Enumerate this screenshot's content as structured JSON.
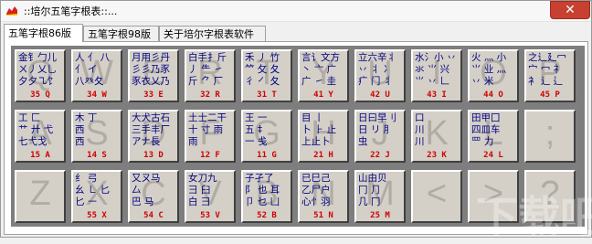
{
  "window": {
    "title": "::培尔五笔字根表::...",
    "close_glyph": "✕"
  },
  "tabs": [
    {
      "label": "五笔字根86版",
      "active": true
    },
    {
      "label": "五笔字根98版",
      "active": false
    },
    {
      "label": "关于培尔字根表软件",
      "active": false
    }
  ],
  "rows": [
    [
      {
        "big": "Q",
        "lines": [
          "金钅勹儿",
          "ㄨ丿乂乚",
          "夕夕㇈饣"
        ],
        "code": "35 Q"
      },
      {
        "big": "W",
        "lines": [
          "人  亻  八",
          "亻   イ",
          "八癶夂"
        ],
        "code": "34 W"
      },
      {
        "big": "E",
        "lines": [
          "月用彡丹",
          "彡彡乃豕",
          "豕衣乂乃"
        ],
        "code": "33 E"
      },
      {
        "big": "R",
        "lines": [
          "白手扌斤",
          "丿  ⺧  ㇀",
          "斤  ⺈  厂"
        ],
        "code": "32 R"
      },
      {
        "big": "T",
        "lines": [
          "禾 丿  竹",
          "⺮  攵  夂",
          "彳  ㇒  夂"
        ],
        "code": "31 T"
      },
      {
        "big": "Y",
        "lines": [
          "言讠文方",
          "丶  亠  广",
          "广  ㇀  圭"
        ],
        "code": "41 Y"
      },
      {
        "big": "U",
        "lines": [
          "立六辛丬",
          "丷  丬  冫",
          "疒  门  丬"
        ],
        "code": "42 U"
      },
      {
        "big": "I",
        "lines": [
          "水氵小 丷",
          "氺  ⺌  兴",
          "⺌  丷  𠃊"
        ],
        "code": "43 I"
      },
      {
        "big": "O",
        "lines": [
          "火 灬  小",
          "⺌  业  灬",
          "  丷  米"
        ],
        "code": "44 O"
      },
      {
        "big": "P",
        "lines": [
          "之辶廴冖",
          "宀  冖  礻",
          "衤  辶  ⻍"
        ],
        "code": "45 P"
      }
    ],
    [
      {
        "big": "A",
        "lines": [
          "工  匚",
          "艹  廾  弋",
          "七弋戈"
        ],
        "code": "15 A"
      },
      {
        "big": "S",
        "lines": [
          "木  丁",
          "  西  ",
          "西"
        ],
        "code": "14 S"
      },
      {
        "big": "D",
        "lines": [
          "大犬古石",
          "三手丰厂",
          "アナ長"
        ],
        "code": "13 D"
      },
      {
        "big": "F",
        "lines": [
          "土士二干",
          "十  寸  雨",
          "雨"
        ],
        "code": "12 F"
      },
      {
        "big": "G",
        "lines": [
          "王    一",
          "  五  ‡",
          "一    戋"
        ],
        "code": "11 G"
      },
      {
        "big": "H",
        "lines": [
          "目  丨",
          "卜  ⺊  止",
          "上止卜"
        ],
        "code": "21 H"
      },
      {
        "big": "J",
        "lines": [
          "日曰早刂",
          "日  リ  ⺼",
          "  虫  "
        ],
        "code": "22 J"
      },
      {
        "big": "K",
        "lines": [
          "口    ",
          "  川  ",
          "川    "
        ],
        "code": "23 K"
      },
      {
        "big": "L",
        "lines": [
          "田甲囗",
          "四皿车",
          "罒  力"
        ],
        "code": "24 L"
      },
      {
        "big": ";",
        "lines": [
          "",
          "",
          ""
        ],
        "code": ""
      }
    ],
    [
      {
        "big": "Z",
        "lines": [
          "",
          "",
          ""
        ],
        "code": ""
      },
      {
        "big": "X",
        "lines": [
          "纟  弓",
          "幺  ㇗  匕",
          "匕  ㇐"
        ],
        "code": "55 X"
      },
      {
        "big": "C",
        "lines": [
          "又ㄡ马",
          "  厶  ",
          "巴  马"
        ],
        "code": "54 C"
      },
      {
        "big": "V",
        "lines": [
          "女刀九",
          "彐  臼",
          "白  彐"
        ],
        "code": "53 V"
      },
      {
        "big": "B",
        "lines": [
          "子孑了",
          "阝  也  耳",
          "卩  乜  凵"
        ],
        "code": "52 B"
      },
      {
        "big": "N",
        "lines": [
          "已巳己",
          "乙尸户",
          "心忄羽"
        ],
        "code": "51 N"
      },
      {
        "big": "M",
        "lines": [
          "山由贝",
          "冂  ⺆",
          "几  冂"
        ],
        "code": "25 M"
      },
      {
        "big": "<",
        "lines": [
          "",
          "",
          ""
        ],
        "code": ""
      },
      {
        "big": ">",
        "lines": [
          "",
          "",
          ""
        ],
        "code": ""
      },
      {
        "big": "?",
        "lines": [
          "",
          "",
          ""
        ],
        "code": ""
      }
    ]
  ],
  "watermark": "下载吧"
}
